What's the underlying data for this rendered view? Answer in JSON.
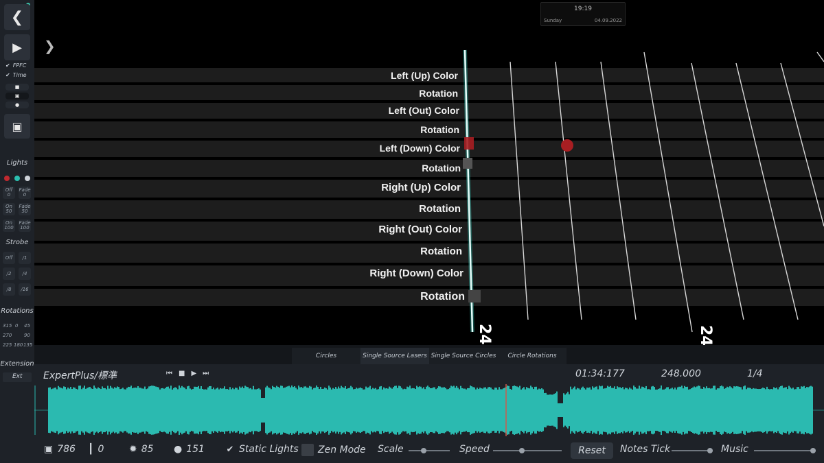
{
  "sidebar": {
    "back_icon": "chevron-left-icon",
    "play_icon": "play-icon",
    "checks": [
      {
        "label": "FPFC",
        "checked": true
      },
      {
        "label": "Time",
        "checked": true
      }
    ],
    "lights_title": "Lights",
    "light_buttons": [
      {
        "line1": "Off",
        "line2": "0"
      },
      {
        "line1": "Fade",
        "line2": "0"
      },
      {
        "line1": "On",
        "line2": "50"
      },
      {
        "line1": "Fade",
        "line2": "50"
      },
      {
        "line1": "On",
        "line2": "100"
      },
      {
        "line1": "Fade",
        "line2": "100"
      }
    ],
    "strobe_title": "Strobe",
    "strobe_buttons": [
      "Off",
      "/1",
      "/2",
      "/4",
      "/8",
      "/16"
    ],
    "rotations_title": "Rotations",
    "rotation_values": [
      "315",
      "0",
      "45",
      "270",
      "90",
      "225",
      "180",
      "135"
    ],
    "extension_title": "Extension",
    "extension_item": "Ext",
    "colors": {
      "red": "#c0292f",
      "teal": "#2bbfb0",
      "white": "#cfd4da",
      "status_dot": "#3cc0a8"
    }
  },
  "clock": {
    "time": "19:19",
    "day": "Sunday",
    "date": "04.09.2022"
  },
  "lanes": [
    "Left (Up) Color",
    "Rotation",
    "Left (Out) Color",
    "Rotation",
    "Left (Down) Color",
    "Rotation",
    "Right (Up) Color",
    "Rotation",
    "Right (Out) Color",
    "Rotation",
    "Right (Down) Color",
    "Rotation"
  ],
  "grid_beat_labels": {
    "left": "24",
    "right": "24"
  },
  "tabs": [
    "Circles",
    "Single Source Lasers",
    "Single Source Circles",
    "Circle Rotations"
  ],
  "timeline": {
    "difficulty": "ExpertPlus/標準",
    "time": "01:34:177",
    "beat": "248.000",
    "precision": "1/4",
    "waveform_color": "#2bbab0"
  },
  "toolbar": {
    "notes_count": "786",
    "bombs_count": "0",
    "lights_count": "85",
    "events_count": "151",
    "static_lights_label": "Static Lights",
    "static_lights_checked": true,
    "zen_mode_label": "Zen Mode",
    "zen_mode_checked": false,
    "scale_label": "Scale",
    "speed_label": "Speed",
    "reset_label": "Reset",
    "notes_tick_label": "Notes Tick",
    "music_label": "Music"
  }
}
